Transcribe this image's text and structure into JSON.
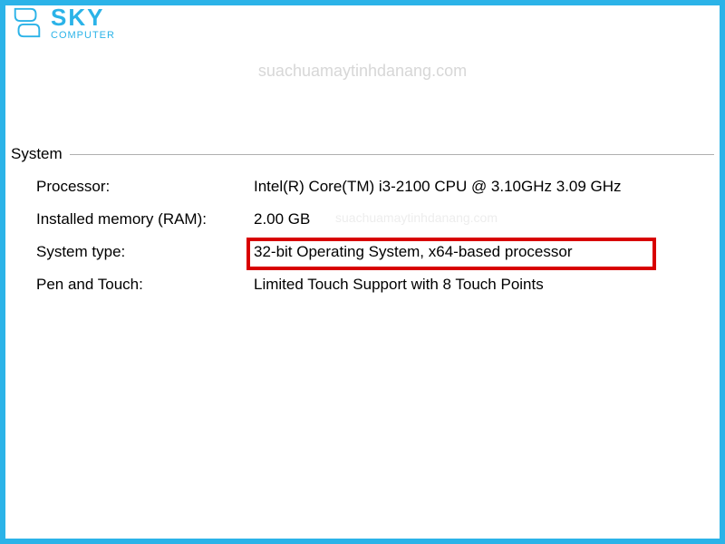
{
  "brand": {
    "name": "SKY",
    "sub": "COMPUTER"
  },
  "watermark": "suachuamaytinhdanang.com",
  "section_title": "System",
  "rows": [
    {
      "label": "Processor:",
      "value": "Intel(R) Core(TM) i3-2100 CPU @ 3.10GHz   3.09 GHz"
    },
    {
      "label": "Installed memory (RAM):",
      "value": "2.00 GB"
    },
    {
      "label": "System type:",
      "value": "32-bit Operating System, x64-based processor"
    },
    {
      "label": "Pen and Touch:",
      "value": "Limited Touch Support with 8 Touch Points"
    }
  ]
}
